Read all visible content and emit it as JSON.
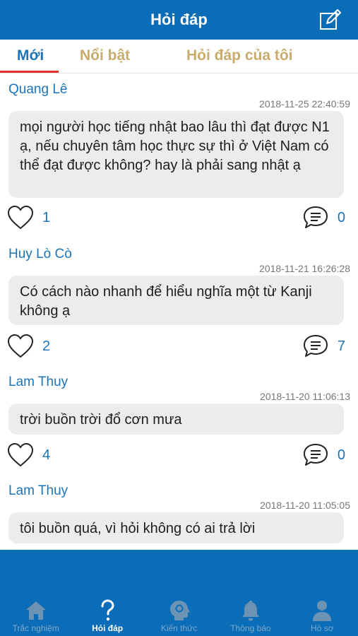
{
  "header": {
    "title": "Hỏi đáp",
    "compose_icon": "compose-icon"
  },
  "tabs": [
    {
      "label": "Mới",
      "active": true
    },
    {
      "label": "Nổi bật",
      "active": false
    },
    {
      "label": "Hỏi đáp của tôi",
      "active": false
    }
  ],
  "posts": [
    {
      "author": "Quang Lê",
      "time": "2018-11-25 22:40:59",
      "content": "mọi người học tiếng nhật bao lâu thì đạt được N1 ạ, nếu chuyên tâm học thực sự thì ở Việt Nam có thể đạt được không? hay là phải sang nhật ạ",
      "likes": "1",
      "comments": "0"
    },
    {
      "author": "Huy Lò Cò",
      "time": "2018-11-21 16:26:28",
      "content": "Có cách nào nhanh để hiểu nghĩa một từ Kanji không ạ",
      "likes": "2",
      "comments": "7"
    },
    {
      "author": "Lam Thuy",
      "time": "2018-11-20 11:06:13",
      "content": "trời buồn trời đổ cơn mưa",
      "likes": "4",
      "comments": "0"
    },
    {
      "author": "Lam Thuy",
      "time": "2018-11-20 11:05:05",
      "content": "tôi buồn quá, vì hỏi không có ai trả lời",
      "likes": "",
      "comments": ""
    }
  ],
  "nav": [
    {
      "label": "Trắc nghiệm",
      "icon": "home-icon",
      "active": false
    },
    {
      "label": "Hỏi đáp",
      "icon": "question-icon",
      "active": true
    },
    {
      "label": "Kiến thức",
      "icon": "brain-icon",
      "active": false
    },
    {
      "label": "Thông báo",
      "icon": "bell-icon",
      "active": false
    },
    {
      "label": "Hồ sơ",
      "icon": "person-icon",
      "active": false
    }
  ],
  "colors": {
    "primary": "#0b6db8",
    "accent": "#1c74b8",
    "tab_inactive": "#c9ab6d",
    "indicator": "#e0312c"
  }
}
